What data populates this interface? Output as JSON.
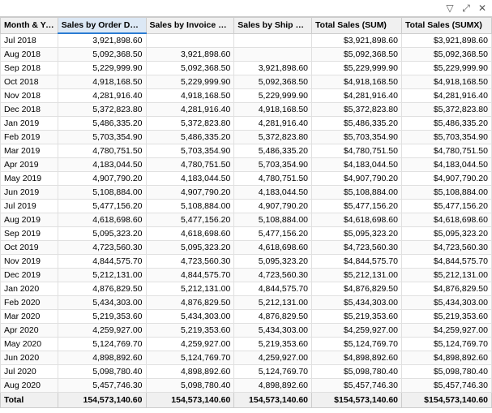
{
  "toolbar": {
    "filter_icon": "▽",
    "expand_icon": "⤢",
    "close_icon": "✕"
  },
  "table": {
    "columns": [
      {
        "id": "month",
        "label": "Month & Year",
        "class": "col-0",
        "active": false
      },
      {
        "id": "order",
        "label": "Sales by Order Date",
        "class": "col-1",
        "active": true
      },
      {
        "id": "invoice",
        "label": "Sales by Invoice Date",
        "class": "col-2",
        "active": false
      },
      {
        "id": "ship",
        "label": "Sales by Ship Date",
        "class": "col-3",
        "active": false
      },
      {
        "id": "total_sum",
        "label": "Total Sales (SUM)",
        "class": "col-4",
        "active": false
      },
      {
        "id": "total_sumx",
        "label": "Total Sales (SUMX)",
        "class": "col-5",
        "active": false
      }
    ],
    "rows": [
      {
        "month": "Jul 2018",
        "order": "3,921,898.60",
        "invoice": "",
        "ship": "",
        "total_sum": "$3,921,898.60",
        "total_sumx": "$3,921,898.60"
      },
      {
        "month": "Aug 2018",
        "order": "5,092,368.50",
        "invoice": "3,921,898.60",
        "ship": "",
        "total_sum": "$5,092,368.50",
        "total_sumx": "$5,092,368.50"
      },
      {
        "month": "Sep 2018",
        "order": "5,229,999.90",
        "invoice": "5,092,368.50",
        "ship": "3,921,898.60",
        "total_sum": "$5,229,999.90",
        "total_sumx": "$5,229,999.90"
      },
      {
        "month": "Oct 2018",
        "order": "4,918,168.50",
        "invoice": "5,229,999.90",
        "ship": "5,092,368.50",
        "total_sum": "$4,918,168.50",
        "total_sumx": "$4,918,168.50"
      },
      {
        "month": "Nov 2018",
        "order": "4,281,916.40",
        "invoice": "4,918,168.50",
        "ship": "5,229,999.90",
        "total_sum": "$4,281,916.40",
        "total_sumx": "$4,281,916.40"
      },
      {
        "month": "Dec 2018",
        "order": "5,372,823.80",
        "invoice": "4,281,916.40",
        "ship": "4,918,168.50",
        "total_sum": "$5,372,823.80",
        "total_sumx": "$5,372,823.80"
      },
      {
        "month": "Jan 2019",
        "order": "5,486,335.20",
        "invoice": "5,372,823.80",
        "ship": "4,281,916.40",
        "total_sum": "$5,486,335.20",
        "total_sumx": "$5,486,335.20"
      },
      {
        "month": "Feb 2019",
        "order": "5,703,354.90",
        "invoice": "5,486,335.20",
        "ship": "5,372,823.80",
        "total_sum": "$5,703,354.90",
        "total_sumx": "$5,703,354.90"
      },
      {
        "month": "Mar 2019",
        "order": "4,780,751.50",
        "invoice": "5,703,354.90",
        "ship": "5,486,335.20",
        "total_sum": "$4,780,751.50",
        "total_sumx": "$4,780,751.50"
      },
      {
        "month": "Apr 2019",
        "order": "4,183,044.50",
        "invoice": "4,780,751.50",
        "ship": "5,703,354.90",
        "total_sum": "$4,183,044.50",
        "total_sumx": "$4,183,044.50"
      },
      {
        "month": "May 2019",
        "order": "4,907,790.20",
        "invoice": "4,183,044.50",
        "ship": "4,780,751.50",
        "total_sum": "$4,907,790.20",
        "total_sumx": "$4,907,790.20"
      },
      {
        "month": "Jun 2019",
        "order": "5,108,884.00",
        "invoice": "4,907,790.20",
        "ship": "4,183,044.50",
        "total_sum": "$5,108,884.00",
        "total_sumx": "$5,108,884.00"
      },
      {
        "month": "Jul 2019",
        "order": "5,477,156.20",
        "invoice": "5,108,884.00",
        "ship": "4,907,790.20",
        "total_sum": "$5,477,156.20",
        "total_sumx": "$5,477,156.20"
      },
      {
        "month": "Aug 2019",
        "order": "4,618,698.60",
        "invoice": "5,477,156.20",
        "ship": "5,108,884.00",
        "total_sum": "$4,618,698.60",
        "total_sumx": "$4,618,698.60"
      },
      {
        "month": "Sep 2019",
        "order": "5,095,323.20",
        "invoice": "4,618,698.60",
        "ship": "5,477,156.20",
        "total_sum": "$5,095,323.20",
        "total_sumx": "$5,095,323.20"
      },
      {
        "month": "Oct 2019",
        "order": "4,723,560.30",
        "invoice": "5,095,323.20",
        "ship": "4,618,698.60",
        "total_sum": "$4,723,560.30",
        "total_sumx": "$4,723,560.30"
      },
      {
        "month": "Nov 2019",
        "order": "4,844,575.70",
        "invoice": "4,723,560.30",
        "ship": "5,095,323.20",
        "total_sum": "$4,844,575.70",
        "total_sumx": "$4,844,575.70"
      },
      {
        "month": "Dec 2019",
        "order": "5,212,131.00",
        "invoice": "4,844,575.70",
        "ship": "4,723,560.30",
        "total_sum": "$5,212,131.00",
        "total_sumx": "$5,212,131.00"
      },
      {
        "month": "Jan 2020",
        "order": "4,876,829.50",
        "invoice": "5,212,131.00",
        "ship": "4,844,575.70",
        "total_sum": "$4,876,829.50",
        "total_sumx": "$4,876,829.50"
      },
      {
        "month": "Feb 2020",
        "order": "5,434,303.00",
        "invoice": "4,876,829.50",
        "ship": "5,212,131.00",
        "total_sum": "$5,434,303.00",
        "total_sumx": "$5,434,303.00"
      },
      {
        "month": "Mar 2020",
        "order": "5,219,353.60",
        "invoice": "5,434,303.00",
        "ship": "4,876,829.50",
        "total_sum": "$5,219,353.60",
        "total_sumx": "$5,219,353.60"
      },
      {
        "month": "Apr 2020",
        "order": "4,259,927.00",
        "invoice": "5,219,353.60",
        "ship": "5,434,303.00",
        "total_sum": "$4,259,927.00",
        "total_sumx": "$4,259,927.00"
      },
      {
        "month": "May 2020",
        "order": "5,124,769.70",
        "invoice": "4,259,927.00",
        "ship": "5,219,353.60",
        "total_sum": "$5,124,769.70",
        "total_sumx": "$5,124,769.70"
      },
      {
        "month": "Jun 2020",
        "order": "4,898,892.60",
        "invoice": "5,124,769.70",
        "ship": "4,259,927.00",
        "total_sum": "$4,898,892.60",
        "total_sumx": "$4,898,892.60"
      },
      {
        "month": "Jul 2020",
        "order": "5,098,780.40",
        "invoice": "4,898,892.60",
        "ship": "5,124,769.70",
        "total_sum": "$5,098,780.40",
        "total_sumx": "$5,098,780.40"
      },
      {
        "month": "Aug 2020",
        "order": "5,457,746.30",
        "invoice": "5,098,780.40",
        "ship": "4,898,892.60",
        "total_sum": "$5,457,746.30",
        "total_sumx": "$5,457,746.30"
      }
    ],
    "footer": {
      "label": "Total",
      "order": "154,573,140.60",
      "invoice": "154,573,140.60",
      "ship": "154,573,140.60",
      "total_sum": "$154,573,140.60",
      "total_sumx": "$154,573,140.60"
    }
  }
}
